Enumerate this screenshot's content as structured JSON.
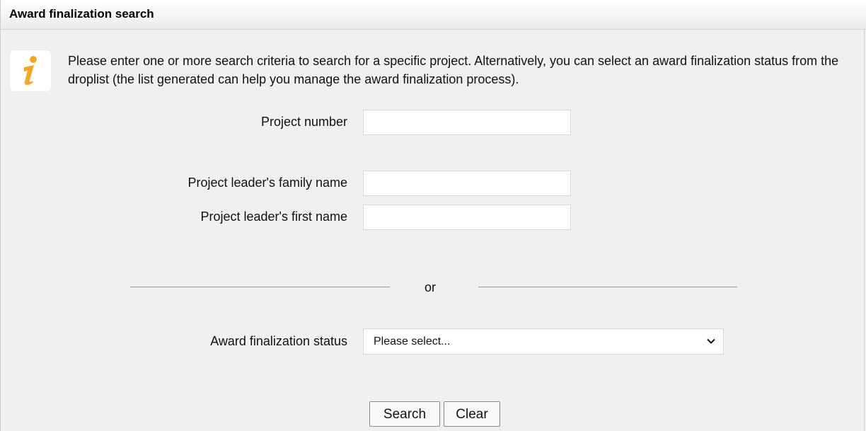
{
  "header": {
    "title": "Award finalization search"
  },
  "info": {
    "icon": "info-icon",
    "text": "Please enter one or more search criteria to search for a specific project. Alternatively, you can select an award finalization status from the droplist (the list generated can help you manage the award finalization process)."
  },
  "form": {
    "project_number": {
      "label": "Project number",
      "value": ""
    },
    "family_name": {
      "label": "Project leader's family name",
      "value": ""
    },
    "first_name": {
      "label": "Project leader's first name",
      "value": ""
    },
    "separator": "or",
    "status": {
      "label": "Award finalization status",
      "selected": "Please select..."
    }
  },
  "buttons": {
    "search": "Search",
    "clear": "Clear"
  },
  "colors": {
    "background": "#f0f0f0",
    "icon_accent": "#f5a623"
  }
}
